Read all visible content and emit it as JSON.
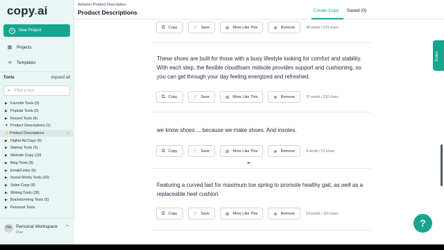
{
  "brand": {
    "logo_main": "copy",
    "logo_dot": ".",
    "logo_tail": "ai"
  },
  "sidebar": {
    "new_project": "New Project",
    "projects": "Projects",
    "templates": "Templates",
    "tools_title": "Tools",
    "expand_all": "expand all",
    "find_placeholder": "Find a tool",
    "tools": [
      {
        "label": "Favorite Tools (0)",
        "expanded": false
      },
      {
        "label": "Popular Tools (5)",
        "expanded": false
      },
      {
        "label": "Recent Tools (6)",
        "expanded": false
      },
      {
        "label": "Product Descriptions (1)",
        "expanded": true
      },
      {
        "label": "Product Descriptions",
        "active": true
      },
      {
        "label": "Digital Ad Copy (9)",
        "expanded": false
      },
      {
        "label": "Startup Tools (5)",
        "expanded": false
      },
      {
        "label": "Website Copy (10)",
        "expanded": false
      },
      {
        "label": "Blog Tools (9)",
        "expanded": false
      },
      {
        "label": "Email/Letter (6)",
        "expanded": false
      },
      {
        "label": "Social Media Tools (16)",
        "expanded": false
      },
      {
        "label": "Sales Copy (8)",
        "expanded": false
      },
      {
        "label": "Writing Tools (28)",
        "expanded": false
      },
      {
        "label": "Brainstorming Tools (5)",
        "expanded": false
      },
      {
        "label": "Personal Tools",
        "expanded": false
      }
    ],
    "workspace": {
      "initials": "PW",
      "name": "Personal Workspace",
      "plan": "Free"
    }
  },
  "header": {
    "breadcrumb": "Amazon Product Description",
    "title": "Product Descriptions",
    "create_copy": "Create Copy",
    "saved": "Saved (0)"
  },
  "actions": {
    "copy": "Copy",
    "save": "Save",
    "more": "More Like This",
    "remove": "Remove"
  },
  "results": [
    {
      "text": "",
      "meta": "48 words / 274 chars"
    },
    {
      "text": "These shoes are built for those with a busy lifestyle looking for comfort and stability. With each step, the flexible cloudfoam midsole provides support and cushioning, so you can get through your day feeling energized and refreshed.",
      "meta": "37 words / 232 chars"
    },
    {
      "text": "we know shoes ... because we make shoes. And insoles.",
      "meta": "9 words / 51 chars"
    },
    {
      "text": "Featuring a curved last for maximum toe spring to promote healthy gait, as well as a replaceable heel cushion.",
      "meta": "19 words / 110 chars"
    }
  ],
  "editor_tab": "Editor",
  "help_label": "?",
  "colors": {
    "accent": "#17a591",
    "sidebar_bg": "#eaf6f4"
  }
}
